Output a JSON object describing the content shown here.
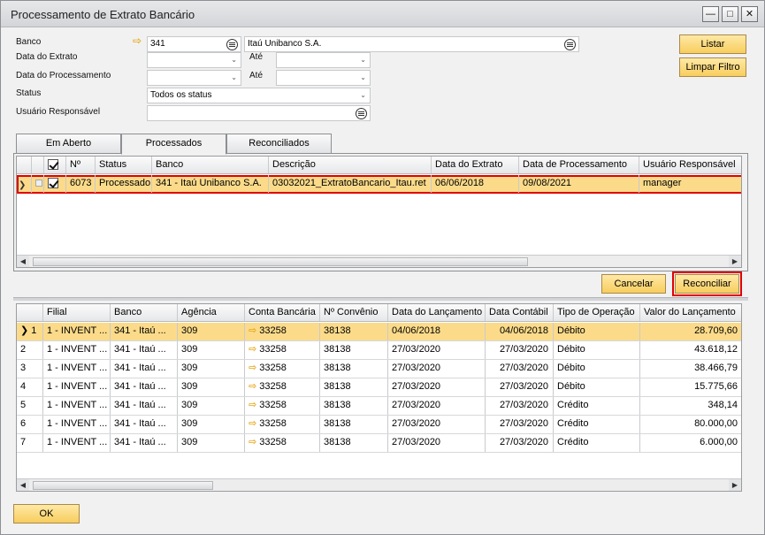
{
  "window": {
    "title": "Processamento de Extrato Bancário",
    "controls": [
      "—",
      "□",
      "✕"
    ]
  },
  "form": {
    "banco_label": "Banco",
    "banco_code": "341",
    "banco_name": "Itaú Unibanco  S.A.",
    "data_extrato_label": "Data do Extrato",
    "data_processamento_label": "Data do Processamento",
    "ate_label": "Até",
    "status_label": "Status",
    "status_value": "Todos os status",
    "usuario_label": "Usuário Responsável",
    "usuario_value": ""
  },
  "actions": {
    "listar": "Listar",
    "limpar": "Limpar Filtro",
    "cancelar": "Cancelar",
    "reconciliar": "Reconciliar",
    "ok": "OK"
  },
  "tabs": [
    "Em Aberto",
    "Processados",
    "Reconciliados"
  ],
  "upper_grid": {
    "columns": [
      "Nº",
      "Status",
      "Banco",
      "Descrição",
      "Data do Extrato",
      "Data de Processamento",
      "Usuário Responsável"
    ],
    "rows": [
      {
        "checked": true,
        "num": "6073",
        "status": "Processado",
        "banco": "341 - Itaú Unibanco  S.A.",
        "descricao": "03032021_ExtratoBancario_Itau.ret",
        "data_extrato": "06/06/2018",
        "data_proc": "09/08/2021",
        "usuario": "manager"
      }
    ]
  },
  "lower_grid": {
    "columns": [
      "Filial",
      "Banco",
      "Agência",
      "Conta Bancária",
      "Nº Convênio",
      "Data do Lançamento",
      "Data Contábil",
      "Tipo de Operação",
      "Valor do Lançamento"
    ],
    "rows": [
      {
        "n": "1",
        "filial": "1 - INVENT ...",
        "banco": "341 - Itaú ...",
        "agencia": "309",
        "conta": "33258",
        "convenio": "38138",
        "data_lanc": "04/06/2018",
        "data_cont": "04/06/2018",
        "tipo": "Débito",
        "valor": "28.709,60"
      },
      {
        "n": "2",
        "filial": "1 - INVENT ...",
        "banco": "341 - Itaú ...",
        "agencia": "309",
        "conta": "33258",
        "convenio": "38138",
        "data_lanc": "27/03/2020",
        "data_cont": "27/03/2020",
        "tipo": "Débito",
        "valor": "43.618,12"
      },
      {
        "n": "3",
        "filial": "1 - INVENT ...",
        "banco": "341 - Itaú ...",
        "agencia": "309",
        "conta": "33258",
        "convenio": "38138",
        "data_lanc": "27/03/2020",
        "data_cont": "27/03/2020",
        "tipo": "Débito",
        "valor": "38.466,79"
      },
      {
        "n": "4",
        "filial": "1 - INVENT ...",
        "banco": "341 - Itaú ...",
        "agencia": "309",
        "conta": "33258",
        "convenio": "38138",
        "data_lanc": "27/03/2020",
        "data_cont": "27/03/2020",
        "tipo": "Débito",
        "valor": "15.775,66"
      },
      {
        "n": "5",
        "filial": "1 - INVENT ...",
        "banco": "341 - Itaú ...",
        "agencia": "309",
        "conta": "33258",
        "convenio": "38138",
        "data_lanc": "27/03/2020",
        "data_cont": "27/03/2020",
        "tipo": "Crédito",
        "valor": "348,14"
      },
      {
        "n": "6",
        "filial": "1 - INVENT ...",
        "banco": "341 - Itaú ...",
        "agencia": "309",
        "conta": "33258",
        "convenio": "38138",
        "data_lanc": "27/03/2020",
        "data_cont": "27/03/2020",
        "tipo": "Crédito",
        "valor": "80.000,00"
      },
      {
        "n": "7",
        "filial": "1 - INVENT ...",
        "banco": "341 - Itaú ...",
        "agencia": "309",
        "conta": "33258",
        "convenio": "38138",
        "data_lanc": "27/03/2020",
        "data_cont": "27/03/2020",
        "tipo": "Crédito",
        "valor": "6.000,00"
      }
    ]
  },
  "colors": {
    "selected_row": "#fbdb8a",
    "button": "#f7cd5d",
    "highlight_border": "#e00000",
    "link_arrow": "#e6a91b"
  }
}
